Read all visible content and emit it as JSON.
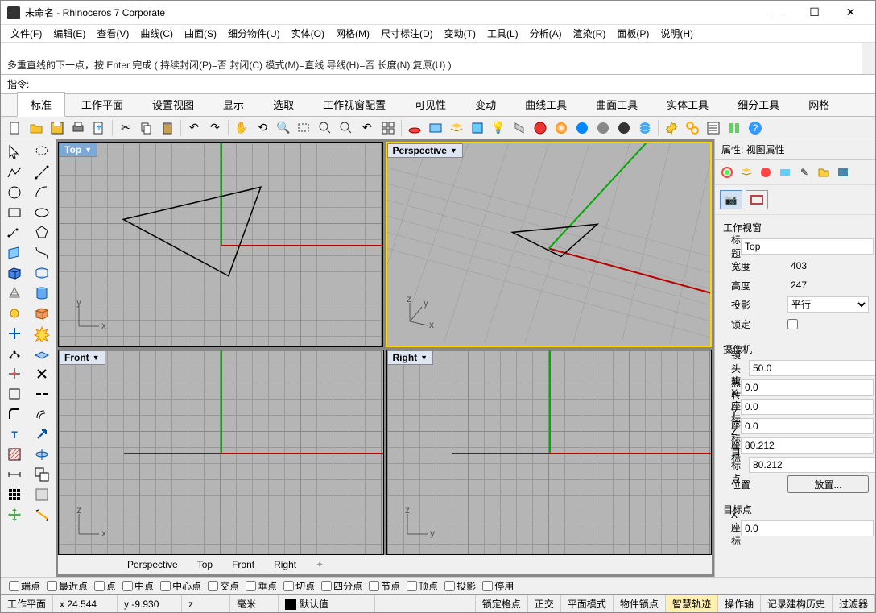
{
  "window": {
    "title": "未命名 - Rhinoceros 7 Corporate"
  },
  "menu": [
    "文件(F)",
    "编辑(E)",
    "查看(V)",
    "曲线(C)",
    "曲面(S)",
    "细分物件(U)",
    "实体(O)",
    "网格(M)",
    "尺寸标注(D)",
    "变动(T)",
    "工具(L)",
    "分析(A)",
    "渲染(R)",
    "面板(P)",
    "说明(H)"
  ],
  "command_history": [
    "多重直线的下一点，按 Enter 完成 ( 持续封闭(P)=否  封闭(C)  模式(M)=直线  导线(H)=否  长度(N)  复原(U) )"
  ],
  "command_prompt": "指令:",
  "tabs": [
    "标准",
    "工作平面",
    "设置视图",
    "显示",
    "选取",
    "工作视窗配置",
    "可见性",
    "变动",
    "曲线工具",
    "曲面工具",
    "实体工具",
    "细分工具",
    "网格"
  ],
  "active_tab": 0,
  "viewports": {
    "top": {
      "label": "Top",
      "axes": [
        "x",
        "y"
      ]
    },
    "perspective": {
      "label": "Perspective",
      "axes": [
        "x",
        "y",
        "z"
      ]
    },
    "front": {
      "label": "Front",
      "axes": [
        "x",
        "z"
      ]
    },
    "right": {
      "label": "Right",
      "axes": [
        "y",
        "z"
      ]
    }
  },
  "viewport_tabs": [
    "Perspective",
    "Top",
    "Front",
    "Right"
  ],
  "properties": {
    "panel_title": "属性: 视图属性",
    "sections": {
      "viewport": {
        "title": "工作视窗",
        "title_label": "标题",
        "title_value": "Top",
        "width_label": "宽度",
        "width_value": "403",
        "height_label": "高度",
        "height_value": "247",
        "projection_label": "投影",
        "projection_value": "平行",
        "lock_label": "锁定"
      },
      "camera": {
        "title": "摄像机",
        "lens_label": "镜头焦...",
        "lens_value": "50.0",
        "rotation_label": "旋转",
        "rotation_value": "0.0",
        "x_label": "X 座标",
        "x_value": "0.0",
        "y_label": "Y 座标",
        "y_value": "0.0",
        "z_label": "Z 座标",
        "z_value": "80.212",
        "target_dist_label": "目标点...",
        "target_dist_value": "80.212",
        "position_label": "位置",
        "position_btn": "放置..."
      },
      "target": {
        "title": "目标点",
        "x_label": "X 座标",
        "x_value": "0.0"
      }
    }
  },
  "osnaps": [
    "端点",
    "最近点",
    "点",
    "中点",
    "中心点",
    "交点",
    "垂点",
    "切点",
    "四分点",
    "节点",
    "顶点",
    "投影",
    "",
    "停用"
  ],
  "status": {
    "cplane": "工作平面",
    "x": "x 24.544",
    "y": "y -9.930",
    "z": "z",
    "unit": "毫米",
    "layer": "默认值",
    "toggles": [
      "锁定格点",
      "正交",
      "平面模式",
      "物件锁点",
      "智慧轨迹",
      "操作轴",
      "记录建构历史",
      "过滤器"
    ]
  }
}
